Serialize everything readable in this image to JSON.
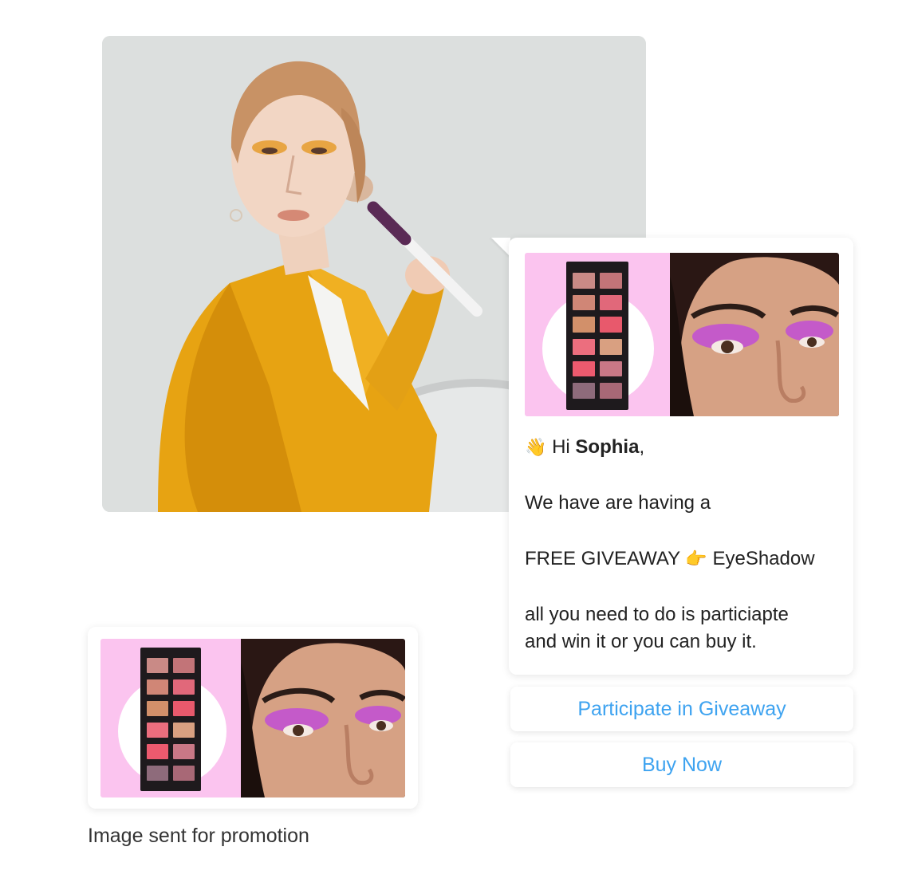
{
  "hero": {
    "alt": "Woman in yellow blazer applying makeup with a brush"
  },
  "promo_image": {
    "palette_colors": [
      "#c98a86",
      "#d08676",
      "#d2906a",
      "#ec6e7e",
      "#c27478",
      "#e1687a",
      "#e8596c",
      "#d9a081",
      "#ec5a6e",
      "#c97886",
      "#8e6b7b",
      "#a86876"
    ],
    "left_bg": "#fbc4ef",
    "eyeshadow": "#c45ac9"
  },
  "message": {
    "greeting_emoji": "👋",
    "greeting_prefix": "Hi",
    "name": "Sophia",
    "greeting_suffix": ",",
    "line1": "We have are having a",
    "line2_pre": "FREE GIVEAWAY",
    "line2_emoji": "👉",
    "line2_post": "EyeShadow",
    "line3a": "all you need to do is particiapte",
    "line3b": "and win it or you can buy it."
  },
  "buttons": {
    "participate": "Participate in Giveaway",
    "buy_now": "Buy Now"
  },
  "caption": "Image sent for promotion",
  "colors": {
    "link_blue": "#3ea3f0",
    "bubble_bg": "#ffffff"
  }
}
